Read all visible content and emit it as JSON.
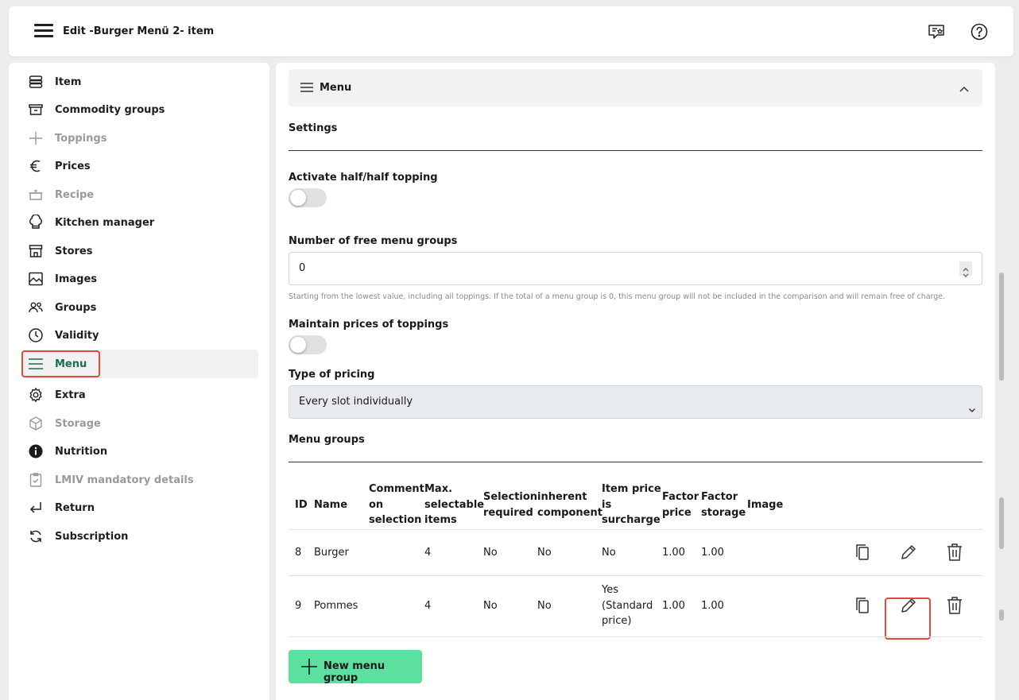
{
  "header": {
    "title": "Edit -Burger Menü 2- item"
  },
  "sidebar": {
    "items": [
      {
        "label": "Item",
        "icon": "item-icon",
        "dim": false
      },
      {
        "label": "Commodity groups",
        "icon": "commodity-groups-icon",
        "dim": false
      },
      {
        "label": "Toppings",
        "icon": "plus-icon",
        "dim": true
      },
      {
        "label": "Prices",
        "icon": "euro-icon",
        "dim": false
      },
      {
        "label": "Recipe",
        "icon": "pot-icon",
        "dim": true
      },
      {
        "label": "Kitchen manager",
        "icon": "chef-hat-icon",
        "dim": false
      },
      {
        "label": "Stores",
        "icon": "store-icon",
        "dim": false
      },
      {
        "label": "Images",
        "icon": "image-icon",
        "dim": false
      },
      {
        "label": "Groups",
        "icon": "users-icon",
        "dim": false
      },
      {
        "label": "Validity",
        "icon": "clock-icon",
        "dim": false
      },
      {
        "label": "Menu",
        "icon": "menu-lines-icon",
        "dim": false,
        "active": true
      },
      {
        "label": "Extra",
        "icon": "gear-icon",
        "dim": false
      },
      {
        "label": "Storage",
        "icon": "box-icon",
        "dim": true
      },
      {
        "label": "Nutrition",
        "icon": "info-icon",
        "dim": false
      },
      {
        "label": "LMIV mandatory details",
        "icon": "clipboard-check-icon",
        "dim": true
      },
      {
        "label": "Return",
        "icon": "return-arrow-icon",
        "dim": false
      },
      {
        "label": "Subscription",
        "icon": "refresh-icon",
        "dim": false
      }
    ]
  },
  "accordion": {
    "label": "Menu"
  },
  "settings": {
    "title": "Settings",
    "half_topping_label": "Activate half/half topping",
    "half_topping_on": false,
    "free_groups_label": "Number of free menu groups",
    "free_groups_value": "0",
    "free_groups_hint": "Starting from the lowest value, including all toppings. If the total of a menu group is 0, this menu group will not be included in the comparison and will remain free of charge.",
    "maintain_prices_label": "Maintain prices of toppings",
    "maintain_prices_on": false,
    "pricing_type_label": "Type of pricing",
    "pricing_type_value": "Every slot individually"
  },
  "menu_groups": {
    "title": "Menu groups",
    "columns": [
      [
        "ID"
      ],
      [
        "Name"
      ],
      [
        "Comment",
        "on",
        "selection"
      ],
      [
        "Max.",
        "selectable",
        "items"
      ],
      [
        "Selection",
        "required"
      ],
      [
        "inherent",
        "component"
      ],
      [
        "Item price",
        "is",
        "surcharge"
      ],
      [
        "Factor",
        "price"
      ],
      [
        "Factor",
        "storage"
      ],
      [
        "Image"
      ]
    ],
    "rows": [
      {
        "id": "8",
        "name": "Burger",
        "comment": "",
        "max": "4",
        "required": "No",
        "inherent": "No",
        "surcharge": [
          "No"
        ],
        "factor_price": "1.00",
        "factor_storage": "1.00",
        "image": ""
      },
      {
        "id": "9",
        "name": "Pommes",
        "comment": "",
        "max": "4",
        "required": "No",
        "inherent": "No",
        "surcharge": [
          "Yes",
          "(Standard",
          "price)"
        ],
        "factor_price": "1.00",
        "factor_storage": "1.00",
        "image": ""
      }
    ],
    "new_button_label": "New menu group"
  }
}
